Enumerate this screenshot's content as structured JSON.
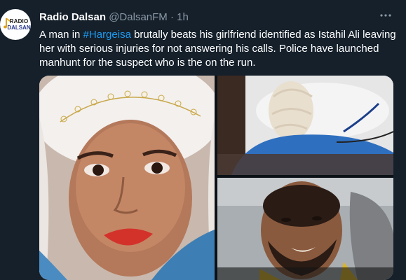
{
  "tweet": {
    "author_name": "Radio Dalsan",
    "handle": "@DalsanFM",
    "separator": "·",
    "time": "1h",
    "avatar": {
      "line1": "RADIO",
      "line2": "DALSAN"
    },
    "more_icon": "more-horizontal-icon",
    "text_before_hashtag": "A man in ",
    "hashtag": "#Hargeisa",
    "text_after_hashtag": " brutally beats his girlfriend identified as Istahil Ali leaving her with serious injuries for not answering his calls. Police have launched manhunt for the suspect who is the on the run.",
    "colors": {
      "background": "#15202b",
      "text": "#ffffff",
      "secondary": "#8b98a5",
      "link": "#1d9bf0"
    }
  }
}
